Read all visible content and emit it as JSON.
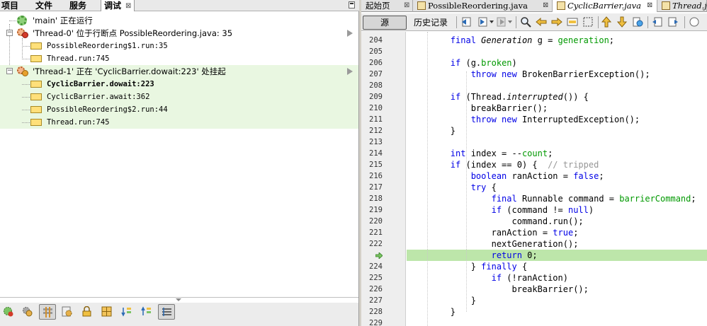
{
  "left_panel": {
    "tabs": [
      {
        "label": "项目",
        "active": false
      },
      {
        "label": "文件",
        "active": false
      },
      {
        "label": "服务",
        "active": false
      },
      {
        "label": "调试",
        "active": true
      }
    ],
    "tree": [
      {
        "text": "'main' 正在运行",
        "kind": "thread-running"
      },
      {
        "text": "'Thread-0' 位于行断点 PossibleReordering.java: 35",
        "kind": "thread-breakpoint"
      },
      {
        "text": "PossibleReordering$1.run:35",
        "kind": "frame"
      },
      {
        "text": "Thread.run:745",
        "kind": "frame"
      },
      {
        "text": "'Thread-1' 正在 'CyclicBarrier.dowait:223' 处挂起",
        "kind": "thread-suspended"
      },
      {
        "text": "CyclicBarrier.dowait:223",
        "kind": "frame-current"
      },
      {
        "text": "CyclicBarrier.await:362",
        "kind": "frame"
      },
      {
        "text": "PossibleReordering$2.run:44",
        "kind": "frame"
      },
      {
        "text": "Thread.run:745",
        "kind": "frame"
      }
    ],
    "toolbar_icons": [
      "resume-icon",
      "threads-icon",
      "show-monitors-icon",
      "show-system-threads-icon",
      "lock-icon",
      "grid-icon",
      "sort-down-icon",
      "sort-up-icon",
      "filter-icon"
    ]
  },
  "editor": {
    "tabs": [
      {
        "label": "起始页",
        "active": false
      },
      {
        "label": "PossibleReordering.java",
        "active": false
      },
      {
        "label": "CyclicBarrier.java",
        "active": true
      },
      {
        "label": "Thread.j",
        "active": false
      }
    ],
    "toolbar": {
      "source_label": "源",
      "history_label": "历史记录"
    },
    "line_numbers": [
      "204",
      "205",
      "206",
      "207",
      "208",
      "209",
      "210",
      "211",
      "212",
      "213",
      "214",
      "215",
      "216",
      "217",
      "218",
      "219",
      "220",
      "221",
      "222",
      "223",
      "224",
      "225",
      "226",
      "227",
      "228",
      "229"
    ],
    "current_line": "223",
    "code": [
      [
        {
          "t": "        "
        },
        {
          "t": "final ",
          "c": "kw"
        },
        {
          "t": "Generation ",
          "c": "it"
        },
        {
          "t": "g = "
        },
        {
          "t": "generation",
          "c": "fld"
        },
        {
          "t": ";"
        }
      ],
      [
        {
          "t": ""
        }
      ],
      [
        {
          "t": "        "
        },
        {
          "t": "if ",
          "c": "kw"
        },
        {
          "t": "(g."
        },
        {
          "t": "broken",
          "c": "fld"
        },
        {
          "t": ")"
        }
      ],
      [
        {
          "t": "            "
        },
        {
          "t": "throw new ",
          "c": "kw"
        },
        {
          "t": "BrokenBarrierException();"
        }
      ],
      [
        {
          "t": ""
        }
      ],
      [
        {
          "t": "        "
        },
        {
          "t": "if ",
          "c": "kw"
        },
        {
          "t": "(Thread."
        },
        {
          "t": "interrupted",
          "c": "it"
        },
        {
          "t": "()) {"
        }
      ],
      [
        {
          "t": "            breakBarrier();"
        }
      ],
      [
        {
          "t": "            "
        },
        {
          "t": "throw new ",
          "c": "kw"
        },
        {
          "t": "InterruptedException();"
        }
      ],
      [
        {
          "t": "        }"
        }
      ],
      [
        {
          "t": ""
        }
      ],
      [
        {
          "t": "        "
        },
        {
          "t": "int ",
          "c": "kw"
        },
        {
          "t": "index = --"
        },
        {
          "t": "count",
          "c": "fld"
        },
        {
          "t": ";"
        }
      ],
      [
        {
          "t": "        "
        },
        {
          "t": "if ",
          "c": "kw"
        },
        {
          "t": "(index == 0) {  "
        },
        {
          "t": "// tripped",
          "c": "cm"
        }
      ],
      [
        {
          "t": "            "
        },
        {
          "t": "boolean ",
          "c": "kw"
        },
        {
          "t": "ranAction = "
        },
        {
          "t": "false",
          "c": "kw"
        },
        {
          "t": ";"
        }
      ],
      [
        {
          "t": "            "
        },
        {
          "t": "try ",
          "c": "kw"
        },
        {
          "t": "{"
        }
      ],
      [
        {
          "t": "                "
        },
        {
          "t": "final ",
          "c": "kw"
        },
        {
          "t": "Runnable command = "
        },
        {
          "t": "barrierCommand",
          "c": "fld"
        },
        {
          "t": ";"
        }
      ],
      [
        {
          "t": "                "
        },
        {
          "t": "if ",
          "c": "kw"
        },
        {
          "t": "(command != "
        },
        {
          "t": "null",
          "c": "kw"
        },
        {
          "t": ")"
        }
      ],
      [
        {
          "t": "                    command.run();"
        }
      ],
      [
        {
          "t": "                ranAction = "
        },
        {
          "t": "true",
          "c": "kw"
        },
        {
          "t": ";"
        }
      ],
      [
        {
          "t": "                nextGeneration();"
        }
      ],
      [
        {
          "t": "                "
        },
        {
          "t": "return ",
          "c": "kw"
        },
        {
          "t": "0;"
        }
      ],
      [
        {
          "t": "            } "
        },
        {
          "t": "finally ",
          "c": "kw"
        },
        {
          "t": "{"
        }
      ],
      [
        {
          "t": "                "
        },
        {
          "t": "if ",
          "c": "kw"
        },
        {
          "t": "(!ranAction)"
        }
      ],
      [
        {
          "t": "                    breakBarrier();"
        }
      ],
      [
        {
          "t": "            }"
        }
      ],
      [
        {
          "t": "        }"
        }
      ],
      [
        {
          "t": ""
        }
      ]
    ]
  }
}
